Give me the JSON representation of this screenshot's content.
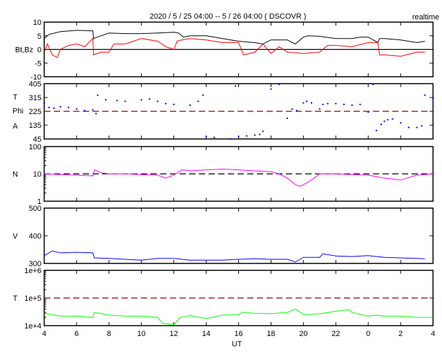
{
  "chart_data": {
    "type": "line",
    "title": "2020 / 5 / 25   04:00 -- 5 / 26  04:00 ( DSCOVR )",
    "subtitle": "realtime",
    "xlabel": "UT",
    "xlim": [
      0,
      24
    ],
    "x_unit": "hours since 2020/5/25 04:00",
    "x_tick_labels": [
      "4",
      "6",
      "8",
      "10",
      "12",
      "14",
      "16",
      "18",
      "20",
      "22",
      "0",
      "2",
      "4"
    ],
    "panels": [
      {
        "ylabel": "Bt,Bz",
        "scale": "linear",
        "ylim": [
          -10,
          10
        ],
        "ticks": [
          10,
          5,
          0,
          -5,
          -10
        ],
        "tick_labels": [
          "10",
          "5",
          "0",
          "-5",
          "-10"
        ],
        "ref_line": {
          "value": 0,
          "style": "solid",
          "color": "#000000"
        },
        "series": [
          {
            "name": "Bt",
            "color": "#000000",
            "style": "line",
            "x": [
              0,
              0.3,
              1,
              2,
              3,
              3.05,
              3.5,
              4,
              5,
              6,
              7,
              8,
              8.3,
              8.6,
              9,
              10,
              11,
              12,
              13,
              13.5,
              14,
              15,
              15.5,
              16,
              16.3,
              17,
              18,
              19,
              19.5,
              20,
              20.6,
              20.7,
              21,
              22,
              23,
              23.5
            ],
            "y": [
              4,
              5.5,
              6.5,
              7,
              6.8,
              4,
              5,
              6,
              5.8,
              5.8,
              6,
              6.3,
              6,
              4.5,
              5,
              5,
              4,
              3,
              2.5,
              2,
              3.5,
              3.5,
              2,
              4.5,
              5,
              4.8,
              4,
              4,
              4.5,
              4.5,
              2.5,
              4,
              4,
              3.5,
              2.5,
              3
            ]
          },
          {
            "name": "Bz",
            "color": "#ff0000",
            "style": "line",
            "x": [
              0,
              0.2,
              0.5,
              0.8,
              1,
              1.5,
              2,
              2.5,
              3,
              3.05,
              3.5,
              4,
              4.3,
              5,
              6,
              7,
              7.5,
              8,
              8.2,
              8.5,
              9,
              10,
              11,
              12,
              12.3,
              13,
              13.5,
              14,
              14.5,
              15,
              16,
              17,
              17.5,
              18,
              19,
              20,
              20.6,
              20.7,
              21,
              22,
              23,
              23.5
            ],
            "y": [
              -1,
              2,
              -2,
              -3,
              0,
              1.5,
              2,
              1,
              4,
              -2,
              -1,
              -1,
              2,
              2,
              4,
              3,
              1,
              0,
              3,
              3.5,
              4,
              3.5,
              2.5,
              2.5,
              -2,
              -1,
              2,
              -1.5,
              1,
              -1,
              -1.5,
              -1,
              1.5,
              1.5,
              1,
              2.5,
              2.5,
              -2,
              -2,
              -2.5,
              -1,
              -1
            ]
          }
        ]
      },
      {
        "ylabel": "T\nPhi\nA",
        "scale": "linear",
        "ylim": [
          45,
          405
        ],
        "ticks": [
          405,
          315,
          225,
          135,
          45
        ],
        "tick_labels": [
          "405",
          "315",
          "225",
          "135",
          "45"
        ],
        "ref_line": {
          "value": 225,
          "style": "dashed",
          "color": "#800000"
        },
        "series": [
          {
            "name": "Phi",
            "color": "#0000ff",
            "style": "dots",
            "x": [
              0,
              0.3,
              0.6,
              1,
              1.5,
              2,
              2.5,
              3,
              3.2,
              3.3,
              3.8,
              4.5,
              5,
              6,
              6.5,
              7,
              7.5,
              8,
              9,
              9.5,
              9.8,
              10,
              10.5,
              11.5,
              11.8,
              12,
              12.5,
              13,
              13.3,
              13.5,
              14,
              14.5,
              15,
              15.3,
              15.6,
              16,
              16.2,
              16.5,
              17,
              17.2,
              17.5,
              18,
              18.5,
              19,
              19.5,
              20,
              20.3,
              20.5,
              20.8,
              21,
              21.2,
              21.5,
              22,
              22.5,
              23,
              23.3,
              23.5,
              24
            ],
            "y": [
              280,
              250,
              245,
              255,
              250,
              240,
              230,
              235,
              210,
              330,
              300,
              295,
              290,
              300,
              305,
              290,
              275,
              270,
              265,
              290,
              330,
              60,
              55,
              45,
              390,
              60,
              65,
              70,
              75,
              95,
              370,
              400,
              180,
              240,
              230,
              280,
              290,
              280,
              240,
              270,
              275,
              275,
              270,
              265,
              270,
              220,
              400,
              100,
              140,
              160,
              170,
              175,
              150,
              120,
              120,
              130,
              330,
              310
            ]
          }
        ]
      },
      {
        "ylabel": "N",
        "scale": "log",
        "ylim": [
          1,
          100
        ],
        "ticks": [
          100,
          10,
          1
        ],
        "tick_labels": [
          "100",
          "10",
          "1"
        ],
        "ref_line": {
          "value": 10,
          "style": "dashed",
          "color": "#000000"
        },
        "series": [
          {
            "name": "N",
            "color": "#ff00ff",
            "style": "line",
            "x": [
              0,
              1,
              2,
              3,
              3.1,
              3.5,
              4,
              5,
              6,
              7,
              7.5,
              8,
              8.5,
              9,
              10,
              11,
              12,
              13,
              14,
              14.5,
              15,
              15.5,
              15.8,
              16,
              16.5,
              17,
              18,
              19,
              20,
              21,
              22,
              23,
              24
            ],
            "y": [
              10,
              9.5,
              9,
              8.5,
              14,
              11,
              10,
              10,
              9.5,
              9,
              7,
              9,
              14,
              13,
              14,
              15,
              14,
              13,
              12,
              10,
              7,
              4,
              3.5,
              4,
              6,
              10,
              10,
              9.5,
              9,
              7,
              6,
              9,
              10
            ]
          }
        ]
      },
      {
        "ylabel": "V",
        "scale": "linear",
        "ylim": [
          300,
          500
        ],
        "ticks": [
          500,
          400,
          300
        ],
        "tick_labels": [
          "500",
          "400",
          "300"
        ],
        "series": [
          {
            "name": "V",
            "color": "#0000ff",
            "style": "line",
            "x": [
              0,
              0.5,
              1,
              2,
              3,
              3.1,
              4,
              5,
              6,
              7,
              8,
              9,
              10,
              11,
              12,
              13,
              14,
              15,
              15.5,
              16,
              17,
              17.2,
              18,
              19,
              20,
              21,
              22,
              23,
              23.5
            ],
            "y": [
              328,
              345,
              338,
              340,
              338,
              320,
              318,
              315,
              312,
              318,
              318,
              312,
              312,
              312,
              315,
              317,
              315,
              315,
              305,
              322,
              322,
              335,
              327,
              325,
              328,
              322,
              320,
              318,
              317
            ]
          }
        ]
      },
      {
        "ylabel": "T",
        "scale": "log",
        "ylim": [
          10000,
          1000000
        ],
        "ticks": [
          1000000,
          100000,
          10000
        ],
        "tick_labels": [
          "1e+6",
          "1e+5",
          "1e+4"
        ],
        "ref_line": {
          "value": 100000,
          "style": "dashed",
          "color": "#800000"
        },
        "series": [
          {
            "name": "T",
            "color": "#00ff00",
            "style": "line",
            "x": [
              0,
              1,
              2,
              3,
              3.1,
              4,
              5,
              6,
              7,
              7.3,
              8,
              8.4,
              9,
              10,
              11,
              12,
              12.2,
              13,
              14,
              15,
              15.5,
              16,
              17,
              18,
              18.8,
              19,
              20,
              20.5,
              21,
              22,
              23,
              24
            ],
            "y": [
              28000,
              22000,
              22000,
              20000,
              30000,
              24000,
              22000,
              22000,
              20000,
              12000,
              11000,
              20000,
              23000,
              18000,
              24000,
              25000,
              30000,
              28000,
              27000,
              30000,
              40000,
              25000,
              27000,
              33000,
              38000,
              30000,
              22000,
              24000,
              22000,
              22000,
              20000,
              20000
            ]
          }
        ]
      }
    ]
  }
}
